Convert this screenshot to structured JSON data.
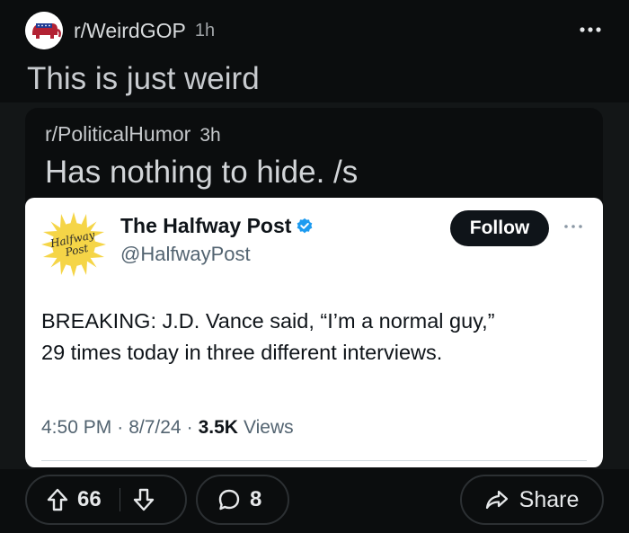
{
  "post": {
    "subreddit": "r/WeirdGOP",
    "age": "1h",
    "title": "This is just weird"
  },
  "crosspost": {
    "subreddit": "r/PoliticalHumor",
    "age": "3h",
    "title": "Has nothing to hide. /s"
  },
  "tweet": {
    "name": "The Halfway Post",
    "handle": "@HalfwayPost",
    "follow_label": "Follow",
    "text_line1": "BREAKING: J.D. Vance said, “I’m a normal guy,”",
    "text_line2": "29 times today in three different interviews.",
    "time": "4:50 PM",
    "date": "8/7/24",
    "views_count": "3.5K",
    "views_label": "Views",
    "meta_sep": "·",
    "logo_text_line1": "Halfway",
    "logo_text_line2": "Post"
  },
  "actions": {
    "upvotes": "66",
    "comments": "8",
    "share_label": "Share"
  },
  "icons": {
    "avatar": "elephant-icon",
    "more": "more-horizontal-icon",
    "verified": "verified-badge-icon",
    "upvote": "arrow-up-icon",
    "downvote": "arrow-down-icon",
    "comment": "comment-bubble-icon",
    "share": "share-arrow-icon"
  },
  "colors": {
    "background": "#0b0d0e",
    "verified_blue": "#1d9bf0",
    "logo_yellow": "#f5d547"
  }
}
